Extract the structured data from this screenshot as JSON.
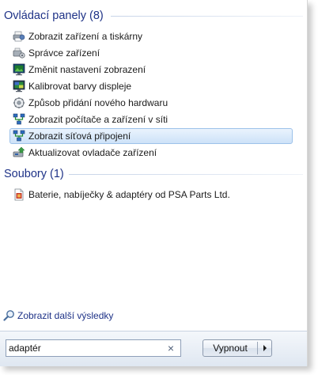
{
  "groups": [
    {
      "title": "Ovládací panely (8)",
      "items": [
        {
          "label": "Zobrazit zařízení a tiskárny",
          "icon": "printer-device-icon"
        },
        {
          "label": "Správce zařízení",
          "icon": "device-manager-icon"
        },
        {
          "label": "Změnit nastavení zobrazení",
          "icon": "display-icon"
        },
        {
          "label": "Kalibrovat barvy displeje",
          "icon": "display-color-icon"
        },
        {
          "label": "Způsob přidání nového hardwaru",
          "icon": "hardware-icon"
        },
        {
          "label": "Zobrazit počítače a zařízení v síti",
          "icon": "network-icon"
        },
        {
          "label": "Zobrazit síťová připojení",
          "icon": "network-icon",
          "selected": true
        },
        {
          "label": "Aktualizovat ovladače zařízení",
          "icon": "driver-icon"
        }
      ]
    },
    {
      "title": "Soubory (1)",
      "items": [
        {
          "label": "Baterie, nabíječky & adaptéry od PSA Parts Ltd.",
          "icon": "document-icon"
        }
      ]
    }
  ],
  "more_results": {
    "label": "Zobrazit další výsledky",
    "icon": "search-icon"
  },
  "search": {
    "value": "adaptér",
    "clear_glyph": "×"
  },
  "shutdown": {
    "label": "Vypnout"
  },
  "colors": {
    "header_text": "#1e3287",
    "link_text": "#1e3287",
    "selection": "#cde2f8"
  }
}
